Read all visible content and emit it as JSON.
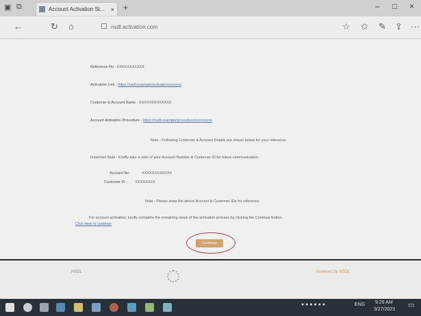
{
  "browser": {
    "tab_title": "Account Activation St...",
    "tab_close": "×",
    "new_tab": "+",
    "nav_back": "←",
    "nav_refresh": "↻",
    "nav_home": "⌂",
    "url": "nsdl.activation.com",
    "window_controls": {
      "minimize": "–",
      "maximize": "□",
      "close": "×"
    },
    "toolbar_icons": [
      "star-icon",
      "favorites-icon",
      "pen-icon",
      "share-icon",
      "more-icon"
    ],
    "more_label": "···"
  },
  "page": {
    "lines": [
      {
        "label": "Reference No :",
        "value": "XXXXXXXXXXX",
        "link": false
      },
      {
        "label": "Activation Link :",
        "value": "https://nsdl.example/activate/xxxxxxxx",
        "link": true
      },
      {
        "label": "Customer & Account Name :",
        "value": "XXXXXXXXXXXXX",
        "link": false
      },
      {
        "label": "Account Activation Procedure :",
        "value": "https://nsdl.example/procedure/xxxxxxxxx",
        "link": true
      }
    ],
    "notice_1": "Note : Following Customer & Account Details are shown below for your reference.",
    "para_1": "Important Note : Kindly take a note of your Account Number & Customer ID for future communication.",
    "detail_1_label": "Account No :",
    "detail_1_value": "XXXXXXXXXXXX",
    "detail_2_label": "Customer ID :",
    "detail_2_value": "XXXXXXXX",
    "notice_2": "Note : Please keep the above Account & Customer IDs for reference.",
    "para_2": "For account activation, kindly complete the remaining steps of the activation process by clicking the Continue button.",
    "para_2_link": "Click here to continue",
    "continue_label": "Continue"
  },
  "lower": {
    "left_text": "NSDL",
    "right_text": "Powered by NSDL"
  },
  "taskbar": {
    "icons": [
      "windows-icon",
      "search-icon",
      "task-view-icon",
      "edge-icon",
      "file-explorer-icon",
      "store-icon",
      "chrome-icon",
      "app-icon",
      "app-icon-2",
      "app-icon-3"
    ],
    "tray_text": "ENG",
    "time": "9:29 AM",
    "date": "3/27/2023"
  },
  "colors": {
    "link": "#3b6fb8",
    "continue_button": "#f2a14a",
    "highlight_ring": "#b8373a",
    "taskbar": "#1f2a36"
  }
}
